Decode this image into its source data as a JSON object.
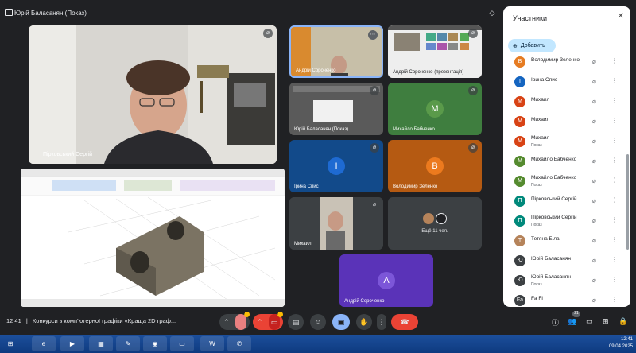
{
  "presenting": {
    "label": "Юрій Баласанян (Показ)"
  },
  "main_tiles": {
    "speaker": {
      "name": "Пірковський Сергій"
    }
  },
  "grid": [
    {
      "id": "t1",
      "name": "Андрій Сороченко"
    },
    {
      "id": "t2",
      "name": "Андрій Сороченко (презентація)"
    },
    {
      "id": "t3",
      "name": "Юрій Баласанян (Показ)"
    },
    {
      "id": "t4",
      "name": "Михайло Бабченко",
      "initial": "M",
      "color": "#3d8b3d"
    },
    {
      "id": "t5",
      "name": "Ірина Спис",
      "initial": "I",
      "color": "#1565c0"
    },
    {
      "id": "t6",
      "name": "Володимир Зеленко",
      "initial": "B",
      "color": "#e67c22"
    },
    {
      "id": "t7",
      "name": "Михаил"
    },
    {
      "id": "t8",
      "others": "Ещё 11 чел."
    },
    {
      "id": "t9",
      "name": "Андрій Сороченко",
      "initial": "A",
      "color": "#5b3fc4"
    }
  ],
  "panel": {
    "title": "Участники",
    "add_label": "Добавить",
    "participants": [
      {
        "initial": "B",
        "color": "#e67c22",
        "name": "Володимир Зеленко",
        "sub": ""
      },
      {
        "initial": "I",
        "color": "#1565c0",
        "name": "Ірина Спис",
        "sub": ""
      },
      {
        "initial": "M",
        "color": "#d84315",
        "name": "Михаил",
        "sub": ""
      },
      {
        "initial": "M",
        "color": "#d84315",
        "name": "Михаил",
        "sub": ""
      },
      {
        "initial": "M",
        "color": "#d84315",
        "name": "Михаил",
        "sub": "Показ"
      },
      {
        "initial": "M",
        "color": "#558b2f",
        "name": "Михайло Бабченко",
        "sub": ""
      },
      {
        "initial": "M",
        "color": "#558b2f",
        "name": "Михайло Бабченко",
        "sub": "Показ"
      },
      {
        "initial": "П",
        "color": "#00897b",
        "name": "Пірковський Сергій",
        "sub": ""
      },
      {
        "initial": "П",
        "color": "#00897b",
        "name": "Пірковський Сергій",
        "sub": "Показ"
      },
      {
        "initial": "Т",
        "color": "#b5835a",
        "name": "Тетяна Біла",
        "sub": ""
      },
      {
        "initial": "Ю",
        "color": "#3c4043",
        "name": "Юрій Баласанян",
        "sub": ""
      },
      {
        "initial": "Ю",
        "color": "#3c4043",
        "name": "Юрій Баласанян",
        "sub": "Показ"
      },
      {
        "initial": "Fa",
        "color": "#3c4043",
        "name": "Fa Fi",
        "sub": ""
      }
    ]
  },
  "bottom": {
    "time": "12:41",
    "separator": "|",
    "meeting_title": "Конкурси з комп'ютерної графіки «Краща 2D граф...",
    "people_count": "21"
  },
  "taskbar": {
    "clock_time": "12:41",
    "clock_date": "09.04.2025"
  }
}
